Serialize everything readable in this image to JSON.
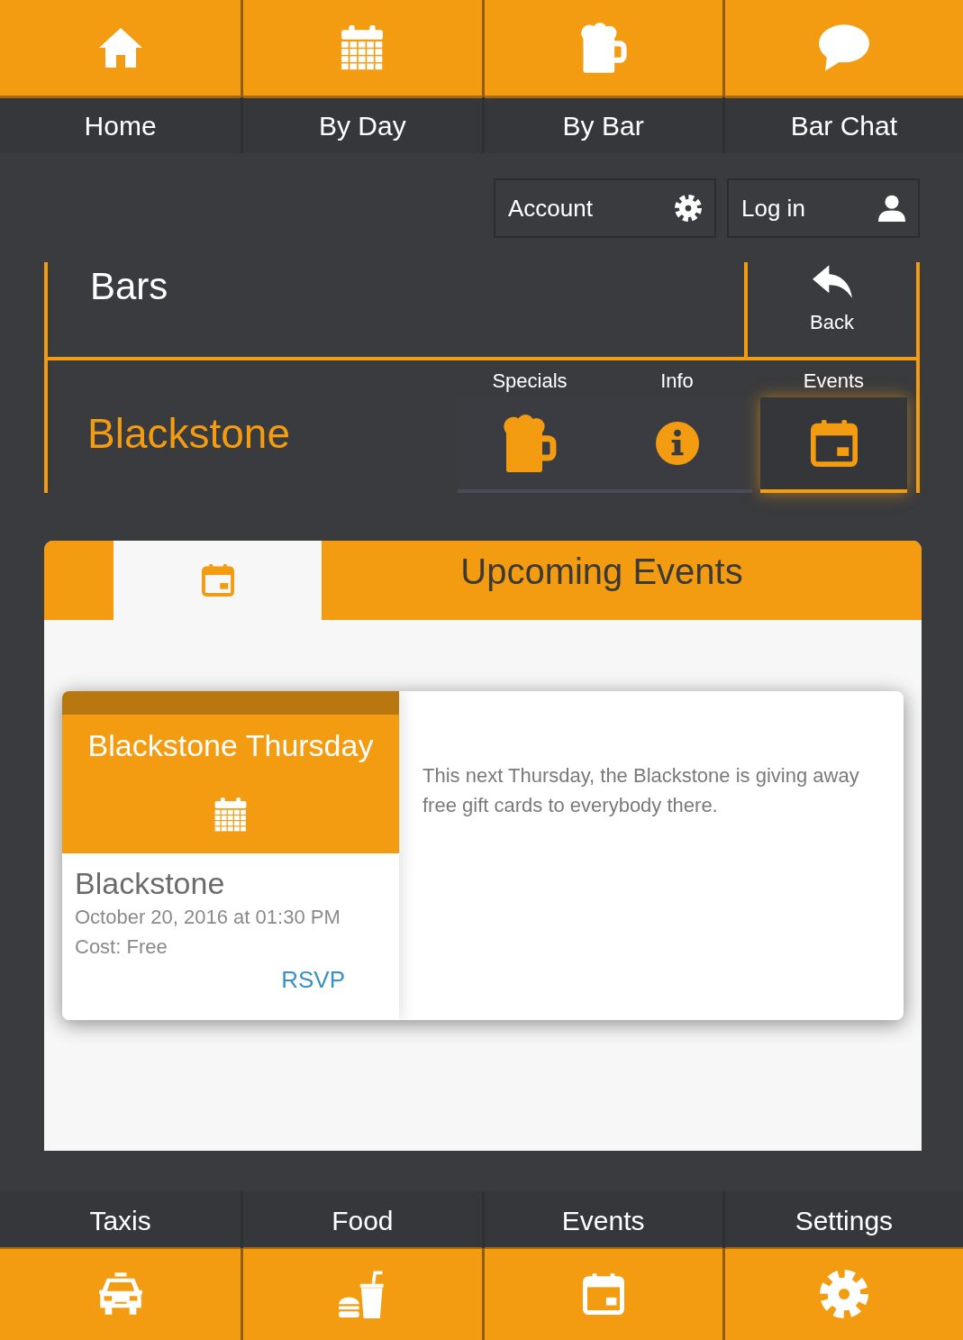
{
  "top_nav": [
    {
      "label": "Home"
    },
    {
      "label": "By Day"
    },
    {
      "label": "By Bar"
    },
    {
      "label": "Bar Chat"
    }
  ],
  "account_bar": [
    {
      "label": "Account"
    },
    {
      "label": "Log in"
    }
  ],
  "bars_header": {
    "title": "Bars",
    "back": "Back"
  },
  "bar": {
    "name": "Blackstone",
    "tabs": [
      {
        "label": "Specials",
        "selected": false
      },
      {
        "label": "Info",
        "selected": false
      },
      {
        "label": "Events",
        "selected": true
      }
    ]
  },
  "events_panel": {
    "title": "Upcoming Events",
    "events": [
      {
        "title": "Blackstone Thursday",
        "venue": "Blackstone",
        "date": "October 20, 2016 at 01:30 PM",
        "cost": "Cost: Free",
        "rsvp": "RSVP",
        "description": "This next Thursday, the Blackstone is giving away free gift cards to everybody there."
      }
    ]
  },
  "bottom_nav": [
    {
      "label": "Taxis"
    },
    {
      "label": "Food"
    },
    {
      "label": "Events"
    },
    {
      "label": "Settings"
    }
  ]
}
